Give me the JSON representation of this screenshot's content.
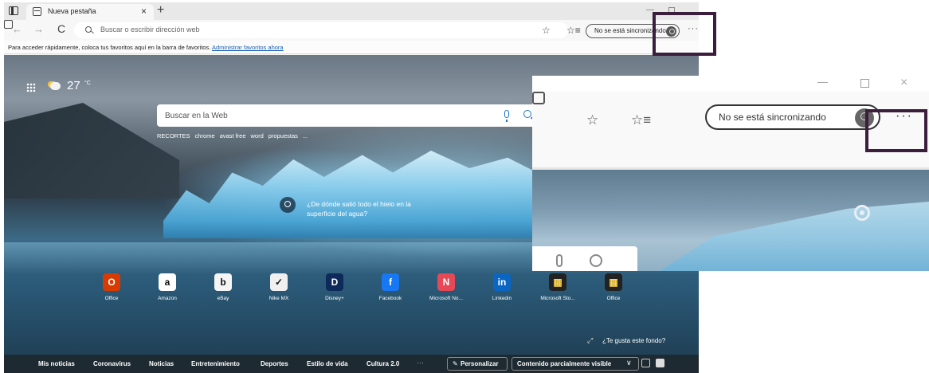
{
  "tab": {
    "title": "Nueva pestaña",
    "close": "×",
    "new_tab": "+"
  },
  "window": {
    "minimize": "—"
  },
  "toolbar": {
    "back": "←",
    "forward": "→",
    "refresh": "C",
    "address_placeholder": "Buscar o escribir dirección web",
    "fav_add": "☆",
    "favorites": "☆≡",
    "sync_label": "No se está sincronizando",
    "more": "···"
  },
  "favbar": {
    "message": "Para acceder rápidamente, coloca tus favoritos aquí en la barra de favoritos.",
    "link": "Administrar favoritos ahora"
  },
  "ntp": {
    "weather_temp": "27",
    "weather_unit": "°C",
    "search_placeholder": "Buscar en la Web",
    "quick_searches": [
      "RECORTES",
      "chrome",
      "avast free",
      "word",
      "propuestas",
      "..."
    ],
    "fact_text": "¿De dónde salió todo el hielo en la superficie del agua?",
    "tiles": [
      {
        "label": "Office",
        "glyph": "O",
        "color": "#d83b01"
      },
      {
        "label": "Amazon",
        "glyph": "a",
        "color": "#ffffff"
      },
      {
        "label": "eBay",
        "glyph": "b",
        "color": "#f5f5f5"
      },
      {
        "label": "Nike MX",
        "glyph": "✓",
        "color": "#f0f0f0"
      },
      {
        "label": "Disney+",
        "glyph": "D",
        "color": "#0e2a5a"
      },
      {
        "label": "Facebook",
        "glyph": "f",
        "color": "#1877f2"
      },
      {
        "label": "Microsoft No...",
        "glyph": "N",
        "color": "#e74856"
      },
      {
        "label": "Linkedin",
        "glyph": "in",
        "color": "#0a66c2"
      },
      {
        "label": "Microsoft Sto...",
        "glyph": "▦",
        "color": "#222222"
      },
      {
        "label": "Office",
        "glyph": "▦",
        "color": "#222222"
      }
    ],
    "bg_expand": "⤢",
    "bg_like": "¿Te gusta este fondo?",
    "news": [
      "Mis noticias",
      "Coronavirus",
      "Noticias",
      "Entretenimiento",
      "Deportes",
      "Estilo de vida",
      "Cultura 2.0"
    ],
    "news_more": "···",
    "personalize": "Personalizar",
    "content_visibility": "Contenido parcialmente visible",
    "chevron": "∨"
  },
  "zoom": {
    "minimize": "—",
    "close": "×",
    "fav_add": "☆",
    "favorites": "☆≡",
    "sync_label": "No se está sincronizando",
    "more": "···"
  }
}
